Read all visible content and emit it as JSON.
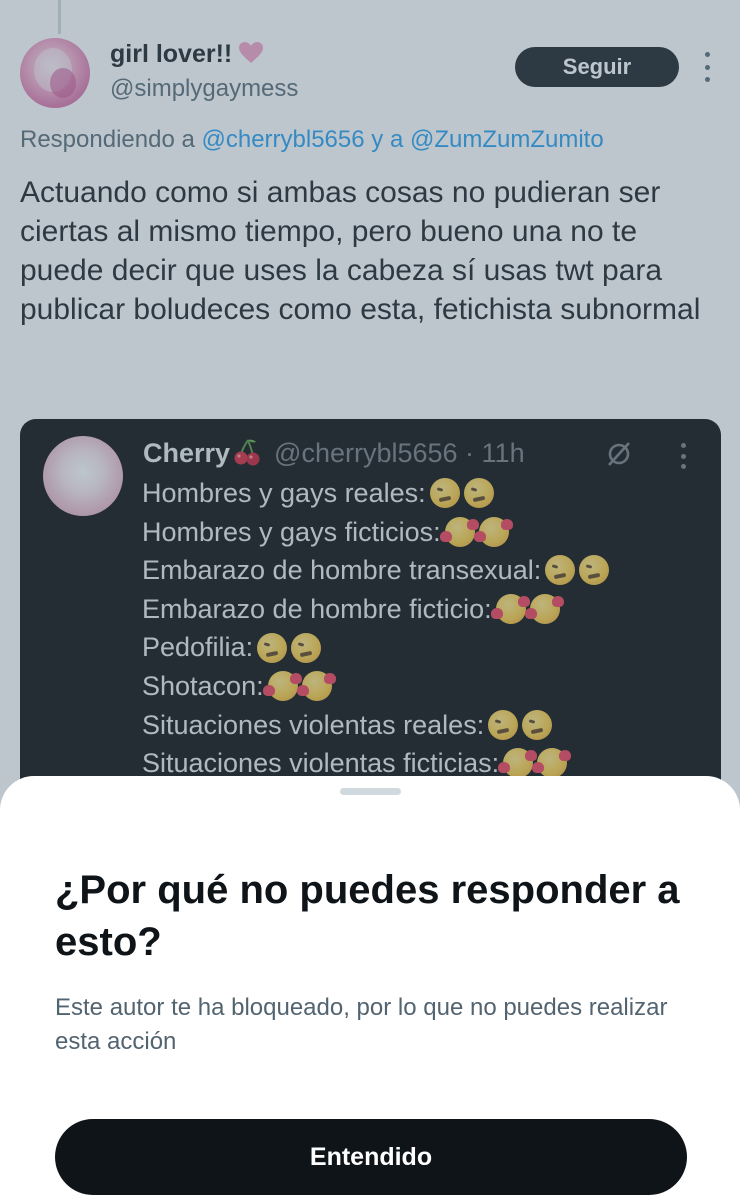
{
  "tweet": {
    "author_name": "girl lover!!",
    "author_handle": "@simplygaymess",
    "follow_label": "Seguir",
    "replying_prefix": "Respondiendo a ",
    "replying_mention_1": "@cherrybl5656",
    "replying_joiner": " y a ",
    "replying_mention_2": "@ZumZumZumito",
    "body": "Actuando como si ambas cosas no pudieran ser ciertas al mismo tiempo, pero bueno una no te puede decir que uses la cabeza sí usas twt para publicar boludeces como esta, fetichista subnormal",
    "name_emoji": "pink-heart-icon"
  },
  "quoted_tweet": {
    "author_name": "Cherry",
    "name_emoji": "cherries-icon",
    "author_handle": "@cherrybl5656 · 11h",
    "lines": [
      {
        "text": "Hombres y gays reales:",
        "emoji": "woozy-face-icon"
      },
      {
        "text": "Hombres y gays ficticios:",
        "emoji": "smiling-face-with-hearts-icon"
      },
      {
        "text": "Embarazo de hombre transexual:",
        "emoji": "woozy-face-icon"
      },
      {
        "text": "Embarazo de hombre ficticio:",
        "emoji": "smiling-face-with-hearts-icon"
      },
      {
        "text": "Pedofilia:",
        "emoji": "woozy-face-icon"
      },
      {
        "text": "Shotacon:",
        "emoji": "smiling-face-with-hearts-icon"
      },
      {
        "text": "Situaciones violentas reales:",
        "emoji": "woozy-face-icon"
      },
      {
        "text": "Situaciones violentas ficticias:",
        "emoji": "smiling-face-with-hearts-icon"
      }
    ]
  },
  "sheet": {
    "title": "¿Por qué no puedes responder a esto?",
    "description": "Este autor te ha bloqueado, por lo que no puedes realizar esta acción",
    "button_label": "Entendido"
  },
  "colors": {
    "text_primary": "#0f1419",
    "text_secondary": "#536471",
    "link_blue": "#1d9bf0",
    "overlay": "rgba(91,112,131,0.40)",
    "quote_bg": "#000000"
  }
}
